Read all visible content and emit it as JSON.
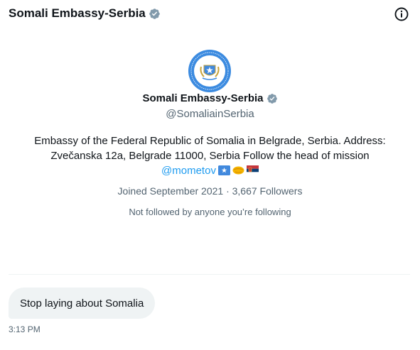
{
  "header": {
    "name": "Somali Embassy-Serbia"
  },
  "profile": {
    "name": "Somali Embassy-Serbia",
    "handle": "@SomaliainSerbia",
    "bio_line1": "Embassy of the Federal Republic of Somalia in Belgrade, Serbia. Address:",
    "bio_line2": "Zvečanska 12a, Belgrade 11000, Serbia Follow the head of mission",
    "bio_mention": "@mometov",
    "meta": "Joined September 2021 · 3,667 Followers",
    "not_followed": "Not followed by anyone you’re following"
  },
  "message": {
    "text": "Stop laying about Somalia",
    "time": "3:13 PM"
  },
  "icons": {
    "verified": "verified-badge-icon",
    "info": "info-icon"
  },
  "colors": {
    "verified_badge": "#829aab",
    "link": "#1d9bf0",
    "secondary_text": "#536471",
    "bubble_bg": "#eff3f4"
  }
}
